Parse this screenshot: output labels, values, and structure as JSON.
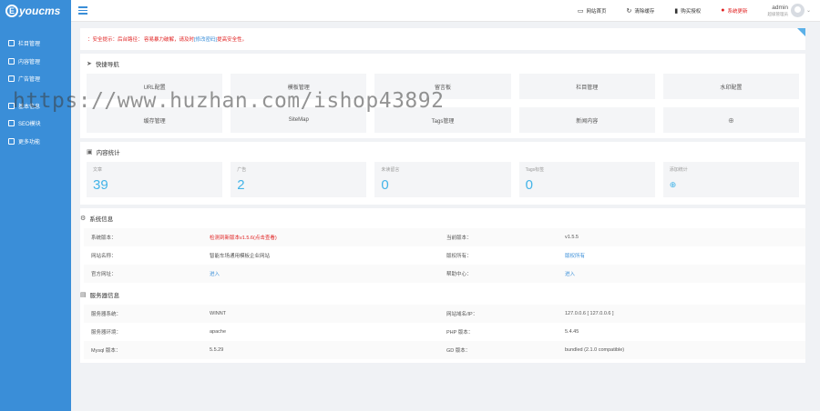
{
  "sidebar": {
    "logo": "youcms",
    "items": [
      {
        "label": "栏目管理",
        "icon": "folder-icon"
      },
      {
        "label": "内容管理",
        "icon": "document-icon"
      },
      {
        "label": "广告管理",
        "icon": "ad-icon"
      },
      {
        "label": "基本信息",
        "icon": "info-icon"
      },
      {
        "label": "SEO模块",
        "icon": "seo-icon"
      },
      {
        "label": "更多功能",
        "icon": "more-icon"
      }
    ]
  },
  "topbar": {
    "links": [
      {
        "label": "网站首页",
        "icon": "monitor-icon",
        "glyph": "▭"
      },
      {
        "label": "清除缓存",
        "icon": "refresh-icon",
        "glyph": "↻"
      },
      {
        "label": "购买授权",
        "icon": "bookmark-icon",
        "glyph": "▮"
      },
      {
        "label": "系统更新",
        "icon": "alert-icon",
        "glyph": "●"
      }
    ],
    "admin_name": "admin",
    "admin_role": "超级管理员"
  },
  "alert": {
    "text": "：安全提示：后台路径：  容易暴力破解，请及时",
    "link": "[修改密码]",
    "after": "提高安全性。"
  },
  "quick_nav": {
    "title": "快捷导航",
    "items": [
      "URL配置",
      "模板管理",
      "留言板",
      "栏目管理",
      "水印配置",
      "缓存管理",
      "SiteMap",
      "Tags管理",
      "新闻内容",
      ""
    ]
  },
  "stats": {
    "title": "内容统计",
    "items": [
      {
        "label": "文章",
        "value": "39"
      },
      {
        "label": "广告",
        "value": "2"
      },
      {
        "label": "未读留言",
        "value": "0"
      },
      {
        "label": "Tags标签",
        "value": "0"
      },
      {
        "label": "添加统计",
        "value": "⊕"
      }
    ]
  },
  "system": {
    "title": "系统信息",
    "rows": [
      [
        "系统版本：",
        "检测到新版本v1.5.6(点击查看)",
        "当前版本：",
        "v1.5.5"
      ],
      [
        "网站名称：",
        "智能车场通用模板企业网站",
        "版权所有：",
        "版权所有"
      ],
      [
        "官方网址：",
        "进入",
        "帮助中心：",
        "进入"
      ]
    ]
  },
  "server": {
    "title": "服务器信息",
    "rows": [
      [
        "服务器系统：",
        "WINNT",
        "网站域名/IP：",
        "127.0.0.6 [ 127.0.0.6 ]"
      ],
      [
        "服务器环境：",
        "apache",
        "PHP 版本：",
        "5.4.45"
      ],
      [
        "Mysql 版本：",
        "5.5.29",
        "GD 版本：",
        "bundled (2.1.0 compatible)"
      ]
    ]
  },
  "watermark": "https://www.huzhan.com/ishop43892"
}
